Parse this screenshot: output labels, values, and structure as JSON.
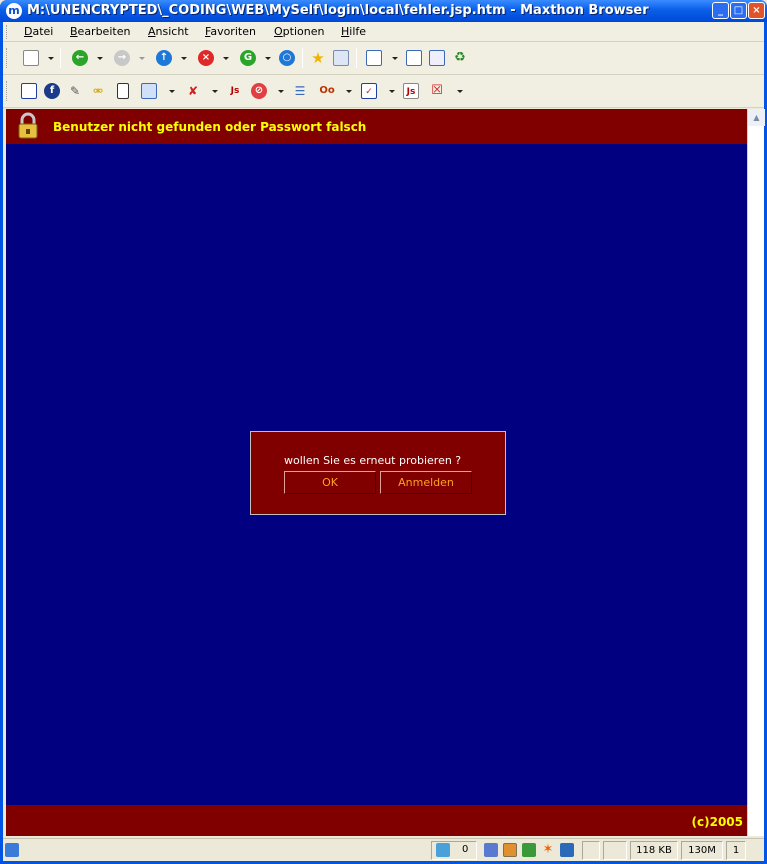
{
  "window": {
    "title": "M:\\UNENCRYPTED\\_CODING\\WEB\\MySelf\\login\\local\\fehler.jsp.htm - Maxthon Browser",
    "app_icon": "m"
  },
  "menu": [
    "Datei",
    "Bearbeiten",
    "Ansicht",
    "Favoriten",
    "Optionen",
    "Hilfe"
  ],
  "toolbar1_icons": [
    "new-page-icon",
    "back-icon",
    "forward-icon",
    "up-icon",
    "stop-icon",
    "go-icon",
    "home-icon",
    "favorites-star-icon",
    "history-icon",
    "layout-icon",
    "fullscreen-icon",
    "split-view-icon",
    "recycle-icon"
  ],
  "toolbar2_icons": [
    "home-page-icon",
    "flash-icon",
    "tools-icon",
    "key-icon",
    "notes-icon",
    "window-icon",
    "popup-blocker-icon",
    "javascript-icon",
    "block-icon",
    "list-icon",
    "proxy-icon",
    "checkbox-icon",
    "javascript-off-icon",
    "close-ads-icon"
  ],
  "page": {
    "error_message": "Benutzer nicht gefunden oder Passwort falsch",
    "dialog": {
      "question": "wollen Sie es erneut probieren ?",
      "ok_label": "OK",
      "login_label": "Anmelden"
    },
    "footer": "(c)2005",
    "colors": {
      "bg": "#000080",
      "bar": "#800000",
      "accent_text": "#ffff00",
      "button_text": "#ffa020"
    }
  },
  "status": {
    "tab_count": "0",
    "page_size": "118 KB",
    "memory": "130M",
    "num": "1"
  }
}
